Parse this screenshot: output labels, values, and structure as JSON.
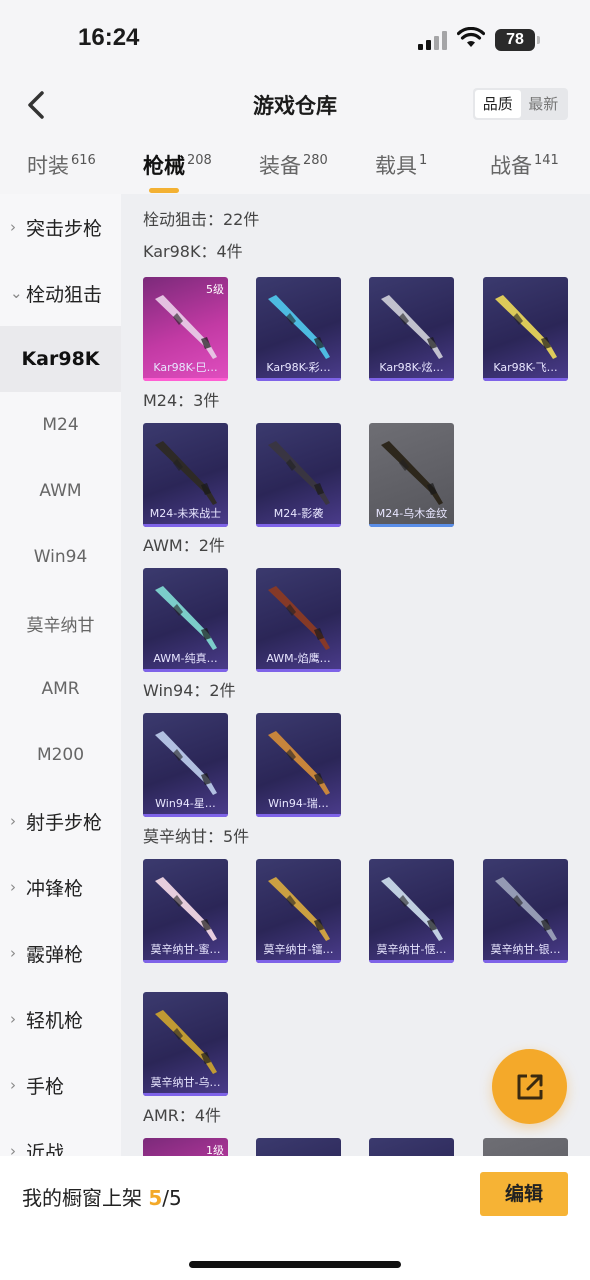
{
  "status": {
    "time": "16:24",
    "battery": "78"
  },
  "nav": {
    "title": "游戏仓库",
    "sort_options": [
      "品质",
      "最新"
    ]
  },
  "tabs": [
    {
      "label": "时装",
      "count": "616"
    },
    {
      "label": "枪械",
      "count": "208"
    },
    {
      "label": "装备",
      "count": "280"
    },
    {
      "label": "载具",
      "count": "1"
    },
    {
      "label": "战备",
      "count": "141"
    }
  ],
  "sidebar": {
    "items": [
      {
        "label": "突击步枪",
        "type": "cat",
        "chev": "›"
      },
      {
        "label": "栓动狙击",
        "type": "cat",
        "chev": "⌄"
      },
      {
        "label": "Kar98K",
        "type": "sub",
        "active": true
      },
      {
        "label": "M24",
        "type": "sub"
      },
      {
        "label": "AWM",
        "type": "sub"
      },
      {
        "label": "Win94",
        "type": "sub"
      },
      {
        "label": "莫辛纳甘",
        "type": "sub"
      },
      {
        "label": "AMR",
        "type": "sub"
      },
      {
        "label": "M200",
        "type": "sub"
      },
      {
        "label": "射手步枪",
        "type": "cat",
        "chev": "›"
      },
      {
        "label": "冲锋枪",
        "type": "cat",
        "chev": "›"
      },
      {
        "label": "霰弹枪",
        "type": "cat",
        "chev": "›"
      },
      {
        "label": "轻机枪",
        "type": "cat",
        "chev": "›"
      },
      {
        "label": "手枪",
        "type": "cat",
        "chev": "›"
      },
      {
        "label": "近战",
        "type": "cat",
        "chev": "›"
      }
    ]
  },
  "content": {
    "summary": "栓动狙击：22件",
    "sections": [
      {
        "label": "Kar98K：4件",
        "items": [
          {
            "name": "Kar98K-巳…",
            "level": "5级",
            "style": "pink",
            "gun": "#e8c9e6"
          },
          {
            "name": "Kar98K-彩…",
            "style": "purple",
            "gun": "#4fc3e8"
          },
          {
            "name": "Kar98K-炫…",
            "style": "purple",
            "gun": "#c9c9d4"
          },
          {
            "name": "Kar98K-飞…",
            "style": "purple",
            "gun": "#e6d35a"
          }
        ]
      },
      {
        "label": "M24：3件",
        "items": [
          {
            "name": "M24-未来战士",
            "style": "purple",
            "gun": "#2e2a24"
          },
          {
            "name": "M24-影袭",
            "style": "purple",
            "gun": "#3a3640"
          },
          {
            "name": "M24-乌木金纹",
            "style": "grey",
            "gun": "#2a2418"
          }
        ]
      },
      {
        "label": "AWM：2件",
        "items": [
          {
            "name": "AWM-纯真…",
            "style": "purple",
            "gun": "#7fd6d0"
          },
          {
            "name": "AWM-焰鹰…",
            "style": "purple",
            "gun": "#8a3a24"
          }
        ]
      },
      {
        "label": "Win94：2件",
        "items": [
          {
            "name": "Win94-星…",
            "style": "purple",
            "gun": "#b8c8e8"
          },
          {
            "name": "Win94-瑞…",
            "style": "purple",
            "gun": "#d08a3a"
          }
        ]
      },
      {
        "label": "莫辛纳甘：5件",
        "items": [
          {
            "name": "莫辛纳甘-蜜…",
            "style": "purple",
            "gun": "#f0d6e4"
          },
          {
            "name": "莫辛纳甘-镭…",
            "style": "purple",
            "gun": "#d4a640"
          },
          {
            "name": "莫辛纳甘-惬…",
            "style": "purple",
            "gun": "#c8d8e8"
          },
          {
            "name": "莫辛纳甘-银…",
            "style": "purple",
            "gun": "#9aa0b8"
          },
          {
            "name": "莫辛纳甘-乌…",
            "style": "purple",
            "gun": "#c8a030"
          }
        ]
      },
      {
        "label": "AMR：4件",
        "items": [
          {
            "name": "",
            "level": "1级",
            "style": "pink",
            "gun": "#e0a0d8"
          },
          {
            "name": "",
            "style": "purple",
            "gun": "#aaa"
          },
          {
            "name": "",
            "style": "purple",
            "gun": "#aaa"
          },
          {
            "name": "",
            "style": "grey",
            "gun": "#aaa"
          }
        ]
      }
    ]
  },
  "bottom": {
    "label": "我的橱窗上架",
    "current": "5",
    "total": "/5",
    "edit": "编辑"
  }
}
